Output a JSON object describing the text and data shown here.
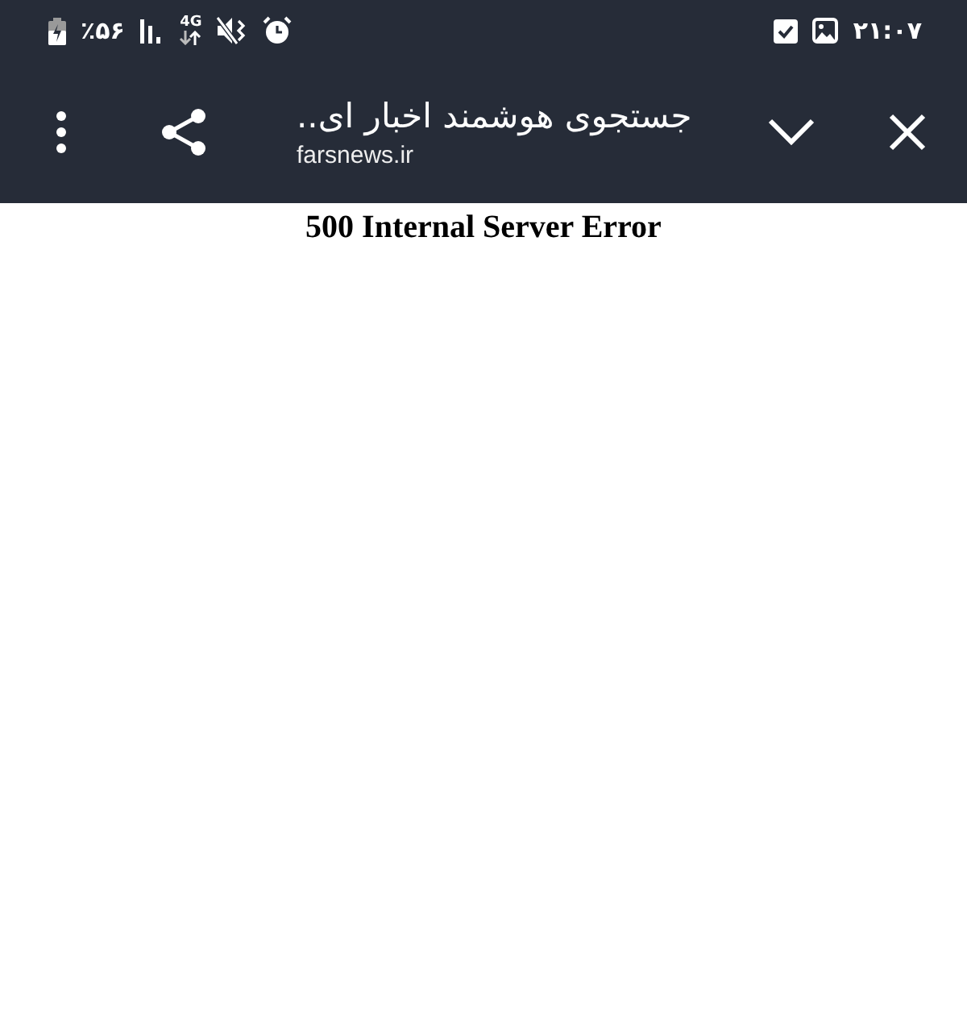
{
  "status_bar": {
    "battery": "٪۵۶",
    "network_type": "4G",
    "time": "۲۱:۰۷"
  },
  "toolbar": {
    "title": "جستجوی هوشمند اخبار ای..",
    "url": "farsnews.ir"
  },
  "page": {
    "heading": "500 Internal Server Error"
  }
}
